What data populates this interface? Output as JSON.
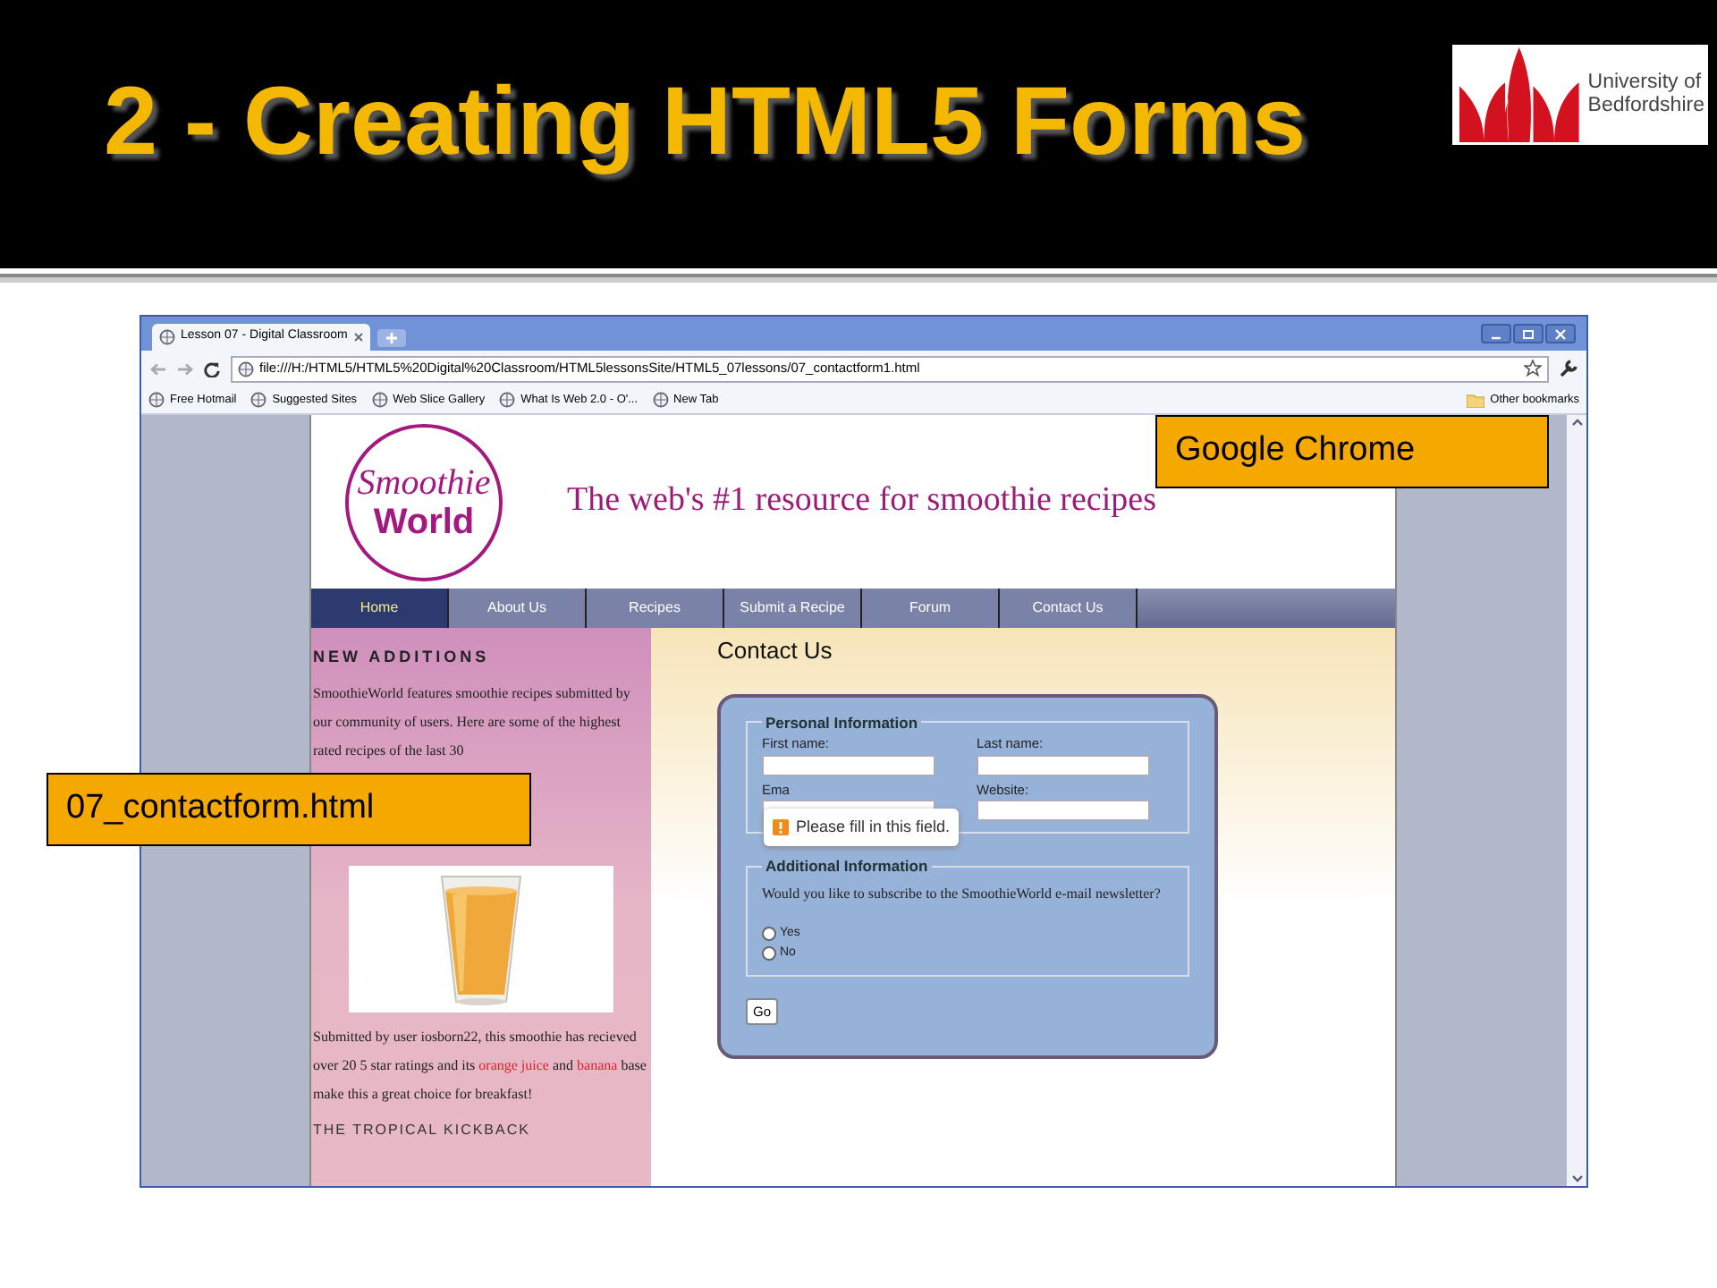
{
  "slide": {
    "title": "2 - Creating HTML5 Forms",
    "logo_lines": [
      "University of",
      "Bedfordshire"
    ]
  },
  "browser": {
    "tab": "Lesson 07 - Digital Classroom",
    "address": "file:///H:/HTML5/HTML5%20Digital%20Classroom/HTML5lessonsSite/HTML5_07lessons/07_contactform1.html",
    "bookmarks": [
      "Free Hotmail",
      "Suggested Sites",
      "Web Slice Gallery",
      "What Is Web 2.0 - O'...",
      "New Tab"
    ],
    "other_bookmarks": "Other bookmarks"
  },
  "site": {
    "logo_lines": [
      "Smoothie",
      "World"
    ],
    "tagline": "The web's #1 resource for smoothie recipes",
    "nav": [
      {
        "label": "Home",
        "selected": true
      },
      {
        "label": "About Us",
        "selected": false
      },
      {
        "label": "Recipes",
        "selected": false
      },
      {
        "label": "Submit a Recipe",
        "selected": false
      },
      {
        "label": "Forum",
        "selected": false
      },
      {
        "label": "Contact Us",
        "selected": false
      }
    ],
    "sidebar": {
      "heading": "NEW ADDITIONS",
      "intro": "SmoothieWorld features smoothie recipes submitted by our community of users. Here are some of the highest rated recipes of the last 30",
      "story": [
        {
          "text": "Submitted by user iosborn22, this smoothie has recieved over 20 5 star ratings and its ",
          "link": false
        },
        {
          "text": "orange juice",
          "link": true
        },
        {
          "text": " and ",
          "link": false
        },
        {
          "text": "banana",
          "link": true
        },
        {
          "text": " base make this a great choice for breakfast!",
          "link": false
        }
      ],
      "next_heading": "THE TROPICAL KICKBACK"
    },
    "main": {
      "heading": "Contact Us",
      "personal": {
        "legend": "Personal Information",
        "fields": [
          {
            "label": "First name:"
          },
          {
            "label": "Last name:"
          },
          {
            "label": "Ema"
          },
          {
            "label": "Website:"
          }
        ]
      },
      "additional": {
        "legend": "Additional Information",
        "question": "Would you like to subscribe to the SmoothieWorld e-mail newsletter?",
        "options": [
          {
            "label": "Yes",
            "selected": false
          },
          {
            "label": "No",
            "selected": false
          }
        ]
      },
      "button": "Go",
      "tooltip": "Please fill in this field."
    }
  },
  "callouts": [
    {
      "text": "Google Chrome"
    },
    {
      "text": "07_contactform.html"
    }
  ]
}
